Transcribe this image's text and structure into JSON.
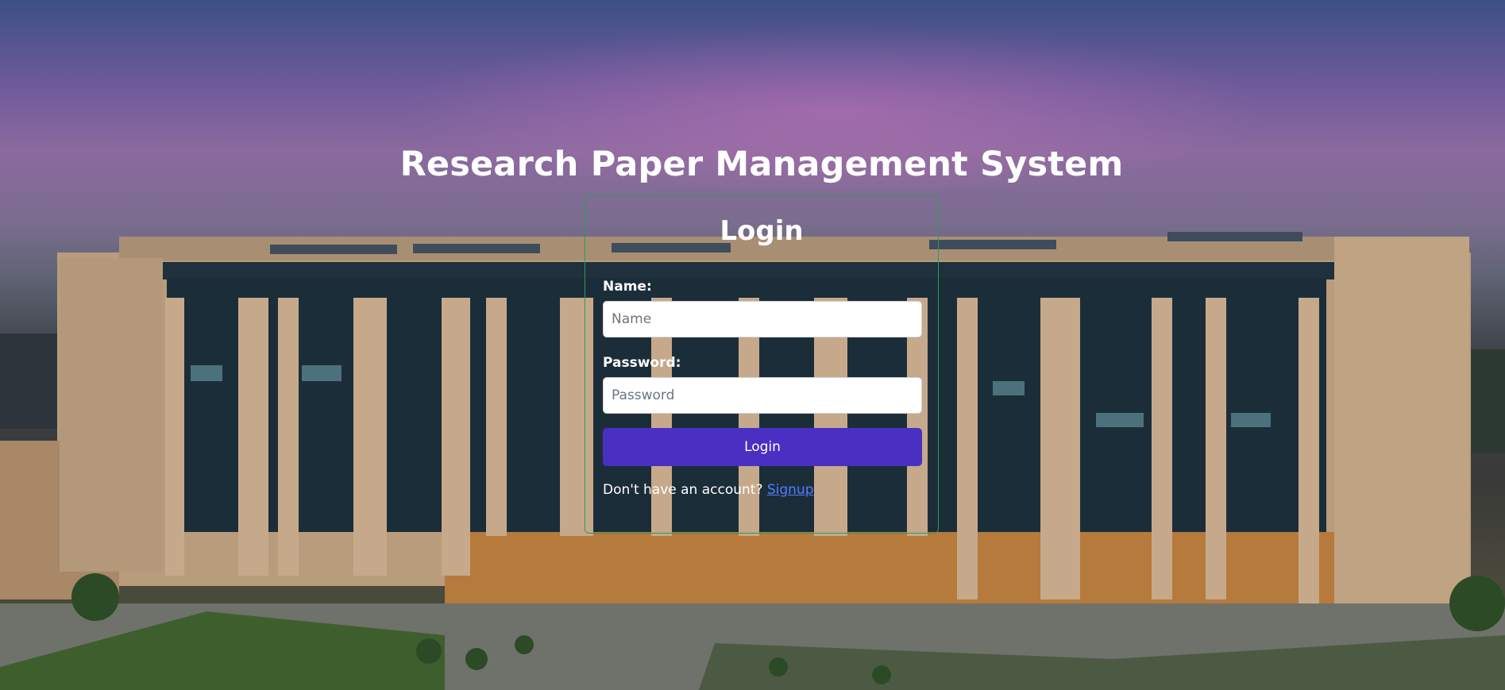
{
  "app": {
    "title": "Research Paper Management System"
  },
  "login": {
    "heading": "Login",
    "name_label": "Name:",
    "name_placeholder": "Name",
    "name_value": "",
    "password_label": "Password:",
    "password_placeholder": "Password",
    "password_value": "",
    "submit_label": "Login",
    "signup_prompt": "Don't have an account?",
    "signup_link": "Signup"
  },
  "colors": {
    "button": "#4930c2",
    "card_border": "#2f9a5a",
    "link": "#4f7dff"
  }
}
